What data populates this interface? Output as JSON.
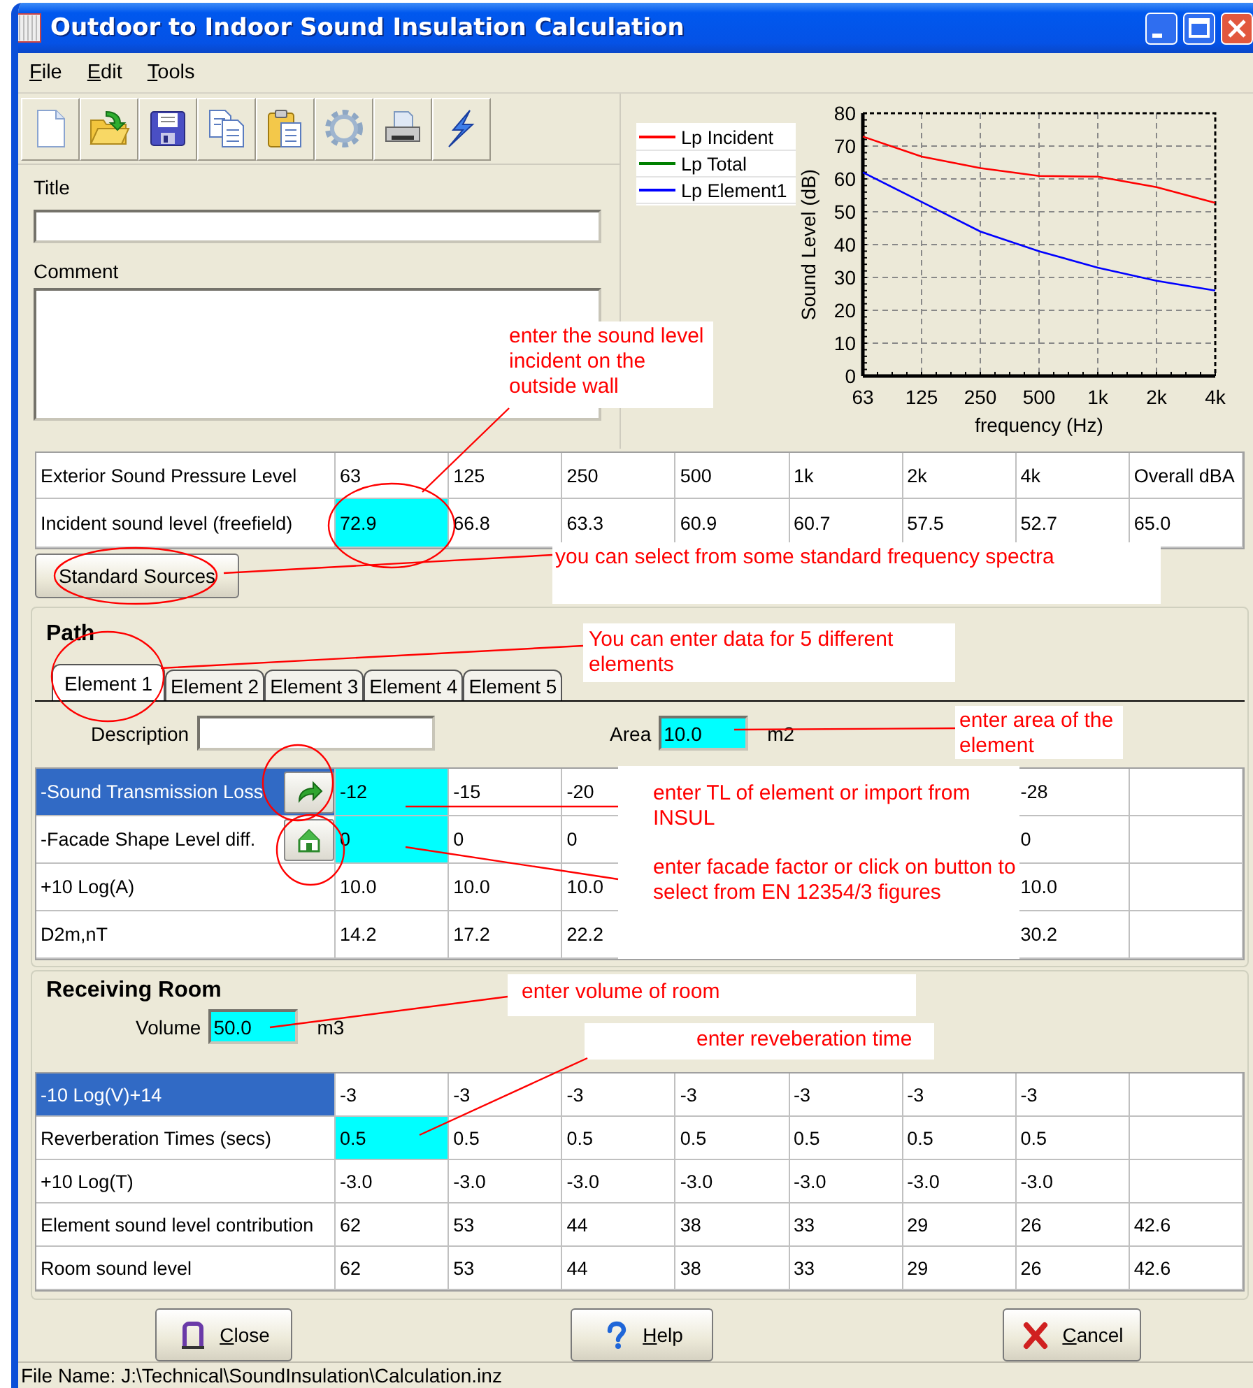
{
  "window": {
    "title": "Outdoor to Indoor Sound Insulation Calculation"
  },
  "menu": [
    "File",
    "Edit",
    "Tools"
  ],
  "toolbar": [
    {
      "kind": "new"
    },
    {
      "kind": "open"
    },
    {
      "kind": "save"
    },
    {
      "kind": "copy"
    },
    {
      "kind": "paste"
    },
    {
      "kind": "settings"
    },
    {
      "kind": "print"
    },
    {
      "kind": "run"
    }
  ],
  "title_field": {
    "label": "Title"
  },
  "comment_field": {
    "label": "Comment"
  },
  "chart": {
    "chart_data": {
      "type": "line",
      "grid": true,
      "xlabel": "frequency (Hz)",
      "ylabel": "Sound Level (dB)",
      "categories": [
        "63",
        "125",
        "250",
        "500",
        "1k",
        "2k",
        "4k"
      ],
      "ylim": [
        0,
        80
      ],
      "yticks": [
        0,
        10,
        20,
        30,
        40,
        50,
        60,
        70,
        80
      ],
      "series": [
        {
          "name": "Lp Incident",
          "color": "#ff0000",
          "values": [
            72.9,
            66.8,
            63.3,
            60.9,
            60.7,
            57.5,
            52.7
          ]
        },
        {
          "name": "Lp Total",
          "color": "#008000",
          "values": [
            null,
            null,
            null,
            null,
            null,
            null,
            null
          ]
        },
        {
          "name": "Lp Element1",
          "color": "#0000ff",
          "values": [
            62,
            53,
            44,
            38,
            33,
            29,
            26
          ]
        }
      ]
    }
  },
  "exterior_table": {
    "columns": [
      "Exterior Sound Pressure Level",
      "63",
      "125",
      "250",
      "500",
      "1k",
      "2k",
      "4k",
      "Overall dBA"
    ],
    "rows": [
      {
        "selected": false,
        "cells": [
          {
            "text": "Incident sound level (freefield)"
          },
          {
            "text": "72.9",
            "highlighted": true
          },
          {
            "text": "66.8",
            "highlighted": false
          },
          {
            "text": "63.3",
            "highlighted": false
          },
          {
            "text": "60.9",
            "highlighted": false
          },
          {
            "text": "60.7",
            "highlighted": false
          },
          {
            "text": "57.5",
            "highlighted": false
          },
          {
            "text": "52.7",
            "highlighted": false
          },
          {
            "text": "65.0",
            "highlighted": false
          }
        ]
      }
    ]
  },
  "standard_sources_button": "Standard Sources",
  "path": {
    "title": "Path",
    "tabs": [
      {
        "label": "Element 1",
        "selected": true
      },
      {
        "label": "Element 2",
        "selected": false
      },
      {
        "label": "Element 3",
        "selected": false
      },
      {
        "label": "Element 4",
        "selected": false
      },
      {
        "label": "Element 5",
        "selected": false
      }
    ],
    "description_label": "Description",
    "area_label": "Area",
    "area_value": "10.0",
    "area_highlighted": true,
    "area_unit": "m2",
    "rows": [
      {
        "kind": "import",
        "label": "-Sound Transmission Loss",
        "selected": true,
        "cells": [
          {
            "text": "-12",
            "highlighted": true
          },
          {
            "text": "-15",
            "highlighted": false
          },
          {
            "text": "-20",
            "highlighted": false
          },
          {},
          {},
          {},
          {
            "text": "-28",
            "highlighted": false
          },
          {
            "highlighted": false
          }
        ]
      },
      {
        "kind": "facade",
        "label": "-Facade Shape Level diff.",
        "selected": false,
        "cells": [
          {
            "text": "0",
            "highlighted": true
          },
          {
            "text": "0",
            "highlighted": false
          },
          {
            "text": "0",
            "highlighted": false
          },
          {},
          {},
          {},
          {
            "text": "0",
            "highlighted": false
          },
          {
            "highlighted": false
          }
        ]
      },
      {
        "kind": "plain",
        "label": "+10 Log(A)",
        "selected": false,
        "cells": [
          {
            "text": "10.0",
            "highlighted": false
          },
          {
            "text": "10.0",
            "highlighted": false
          },
          {
            "text": "10.0",
            "highlighted": false
          },
          {},
          {},
          {},
          {
            "text": "10.0",
            "highlighted": false
          },
          {
            "highlighted": false
          }
        ]
      },
      {
        "kind": "plain",
        "label": "D2m,nT",
        "selected": false,
        "cells": [
          {
            "text": "14.2",
            "highlighted": false
          },
          {
            "text": "17.2",
            "highlighted": false
          },
          {
            "text": "22.2",
            "highlighted": false
          },
          {},
          {},
          {},
          {
            "text": "30.2",
            "highlighted": false
          },
          {
            "highlighted": false
          }
        ]
      }
    ]
  },
  "receiving_room": {
    "title": "Receiving Room",
    "volume_label": "Volume",
    "volume_value": "50.0",
    "volume_highlighted": true,
    "volume_unit": "m3",
    "rows": [
      {
        "label": "-10 Log(V)+14",
        "selected": true,
        "cells": [
          {
            "text": "-3",
            "highlighted": false
          },
          {
            "text": "-3",
            "highlighted": false
          },
          {
            "text": "-3",
            "highlighted": false
          },
          {
            "text": "-3",
            "highlighted": false
          },
          {
            "text": "-3",
            "highlighted": false
          },
          {
            "text": "-3",
            "highlighted": false
          },
          {
            "text": "-3",
            "highlighted": false
          },
          {
            "highlighted": false
          }
        ]
      },
      {
        "label": "Reverberation Times (secs)",
        "selected": false,
        "cells": [
          {
            "text": "0.5",
            "highlighted": true
          },
          {
            "text": "0.5",
            "highlighted": false
          },
          {
            "text": "0.5",
            "highlighted": false
          },
          {
            "text": "0.5",
            "highlighted": false
          },
          {
            "text": "0.5",
            "highlighted": false
          },
          {
            "text": "0.5",
            "highlighted": false
          },
          {
            "text": "0.5",
            "highlighted": false
          },
          {
            "highlighted": false
          }
        ]
      },
      {
        "label": "+10 Log(T)",
        "selected": false,
        "cells": [
          {
            "text": "-3.0",
            "highlighted": false
          },
          {
            "text": "-3.0",
            "highlighted": false
          },
          {
            "text": "-3.0",
            "highlighted": false
          },
          {
            "text": "-3.0",
            "highlighted": false
          },
          {
            "text": "-3.0",
            "highlighted": false
          },
          {
            "text": "-3.0",
            "highlighted": false
          },
          {
            "text": "-3.0",
            "highlighted": false
          },
          {
            "highlighted": false
          }
        ]
      },
      {
        "label": "Element sound level contribution",
        "selected": false,
        "cells": [
          {
            "text": "62",
            "highlighted": false
          },
          {
            "text": "53",
            "highlighted": false
          },
          {
            "text": "44",
            "highlighted": false
          },
          {
            "text": "38",
            "highlighted": false
          },
          {
            "text": "33",
            "highlighted": false
          },
          {
            "text": "29",
            "highlighted": false
          },
          {
            "text": "26",
            "highlighted": false
          },
          {
            "text": "42.6",
            "highlighted": false
          }
        ]
      },
      {
        "label": "Room sound level",
        "selected": false,
        "cells": [
          {
            "text": "62",
            "highlighted": false
          },
          {
            "text": "53",
            "highlighted": false
          },
          {
            "text": "44",
            "highlighted": false
          },
          {
            "text": "38",
            "highlighted": false
          },
          {
            "text": "33",
            "highlighted": false
          },
          {
            "text": "29",
            "highlighted": false
          },
          {
            "text": "26",
            "highlighted": false
          },
          {
            "text": "42.6",
            "highlighted": false
          }
        ]
      }
    ]
  },
  "buttons": [
    {
      "kind": "close",
      "label": "Close"
    },
    {
      "kind": "help",
      "label": "Help"
    },
    {
      "kind": "cancel",
      "label": "Cancel"
    }
  ],
  "status_bar": "File Name: J:\\Technical\\SoundInsulation\\Calculation.inz",
  "annotations": [
    {
      "text": "enter the sound level incident on the outside wall"
    },
    {
      "text": "you can select from some standard frequency spectra"
    },
    {
      "text": "You can enter data for 5 different elements"
    },
    {
      "text": "enter area of the element"
    },
    {
      "text": "enter TL of element or import from INSUL"
    },
    {
      "text": "enter facade factor or click on button to select from EN 12354/3 figures"
    },
    {
      "text": "enter volume of room"
    },
    {
      "text": "enter reveberation time"
    }
  ]
}
